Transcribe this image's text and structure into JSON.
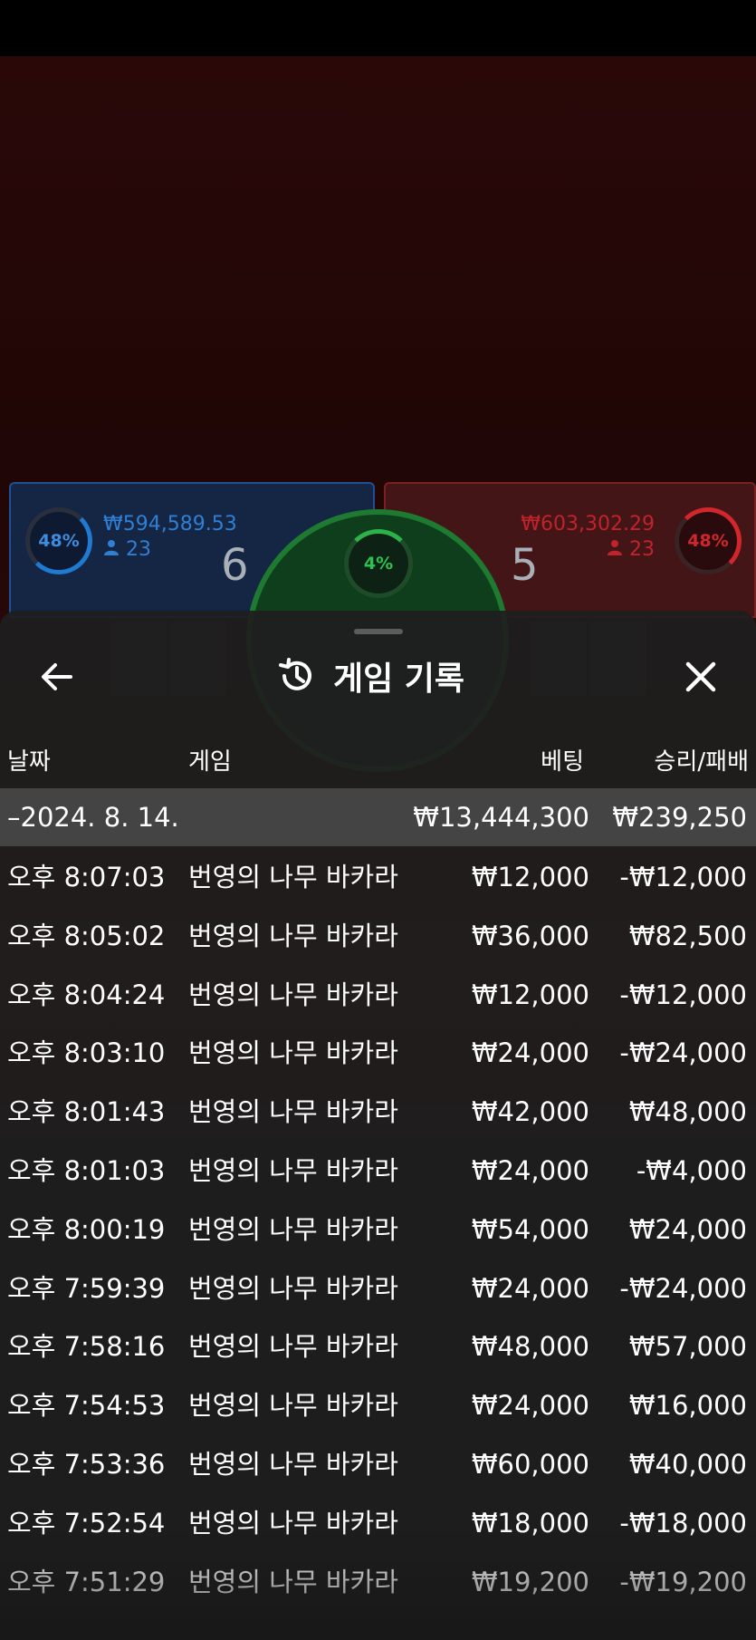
{
  "game_panels": {
    "player": {
      "percent": "48%",
      "amount": "₩594,589.53",
      "count": "23",
      "score": "6"
    },
    "tie": {
      "percent": "4%"
    },
    "banker": {
      "percent": "48%",
      "amount": "₩603,302.29",
      "count": "23",
      "score": "5"
    }
  },
  "modal": {
    "title": "게임 기록",
    "columns": {
      "date": "날짜",
      "game": "게임",
      "bet": "베팅",
      "result": "승리/패배"
    },
    "date_group": {
      "label": "–2024. 8. 14.",
      "total_bet": "₩13,444,300",
      "total_result": "₩239,250"
    },
    "rows": [
      {
        "time": "오후 8:07:03",
        "game": "번영의 나무 바카라",
        "bet": "₩12,000",
        "result": "-₩12,000"
      },
      {
        "time": "오후 8:05:02",
        "game": "번영의 나무 바카라",
        "bet": "₩36,000",
        "result": "₩82,500"
      },
      {
        "time": "오후 8:04:24",
        "game": "번영의 나무 바카라",
        "bet": "₩12,000",
        "result": "-₩12,000"
      },
      {
        "time": "오후 8:03:10",
        "game": "번영의 나무 바카라",
        "bet": "₩24,000",
        "result": "-₩24,000"
      },
      {
        "time": "오후 8:01:43",
        "game": "번영의 나무 바카라",
        "bet": "₩42,000",
        "result": "₩48,000"
      },
      {
        "time": "오후 8:01:03",
        "game": "번영의 나무 바카라",
        "bet": "₩24,000",
        "result": "-₩4,000"
      },
      {
        "time": "오후 8:00:19",
        "game": "번영의 나무 바카라",
        "bet": "₩54,000",
        "result": "₩24,000"
      },
      {
        "time": "오후 7:59:39",
        "game": "번영의 나무 바카라",
        "bet": "₩24,000",
        "result": "-₩24,000"
      },
      {
        "time": "오후 7:58:16",
        "game": "번영의 나무 바카라",
        "bet": "₩48,000",
        "result": "₩57,000"
      },
      {
        "time": "오후 7:54:53",
        "game": "번영의 나무 바카라",
        "bet": "₩24,000",
        "result": "₩16,000"
      },
      {
        "time": "오후 7:53:36",
        "game": "번영의 나무 바카라",
        "bet": "₩60,000",
        "result": "₩40,000"
      },
      {
        "time": "오후 7:52:54",
        "game": "번영의 나무 바카라",
        "bet": "₩18,000",
        "result": "-₩18,000"
      },
      {
        "time": "오후 7:51:29",
        "game": "번영의 나무 바카라",
        "bet": "₩19,200",
        "result": "-₩19,200"
      }
    ]
  },
  "colors": {
    "player_blue": "#2f7fd4",
    "banker_red": "#c0232a",
    "tie_green": "#2bc24f",
    "sheet_bg": "#1e1e1e",
    "date_row_bg": "#444444"
  },
  "icons": {
    "back": "arrow-left-icon",
    "history": "history-icon",
    "close": "close-icon",
    "user": "user-icon"
  }
}
